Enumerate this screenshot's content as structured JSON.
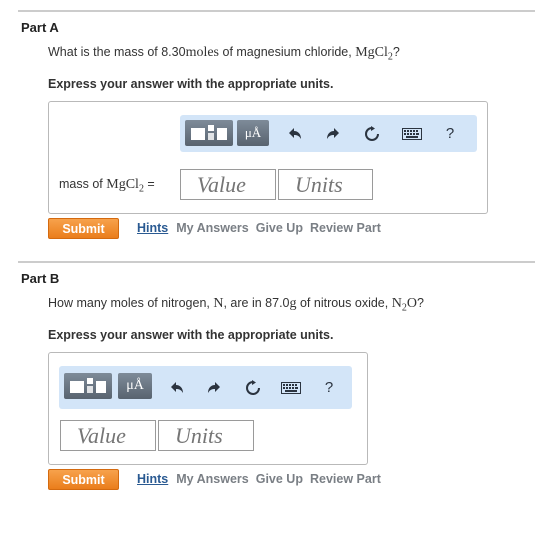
{
  "partA": {
    "title": "Part A",
    "question_pre": "What is the mass of 8.30",
    "question_unit": "moles",
    "question_mid": " of magnesium chloride, ",
    "question_formula_main": "MgCl",
    "question_formula_sub": "2",
    "question_post": "?",
    "instruction": "Express your answer with the appropriate units.",
    "label_pre": "mass of ",
    "label_formula_main": "MgCl",
    "label_formula_sub": "2",
    "label_eq": " =",
    "value_placeholder": "Value",
    "units_placeholder": "Units",
    "submit": "Submit",
    "hints": "Hints",
    "my_answers": "My Answers",
    "give_up": "Give Up",
    "review": "Review Part",
    "toolbar": {
      "micro": "μÅ",
      "help": "?"
    }
  },
  "partB": {
    "title": "Part B",
    "question_pre": "How many moles of nitrogen, ",
    "question_element": "N",
    "question_mid": ", are in 87.0",
    "question_unit": "g",
    "question_mid2": " of nitrous oxide, ",
    "question_formula_main": "N",
    "question_formula_sub": "2",
    "question_formula_end": "O",
    "question_post": "?",
    "instruction": "Express your answer with the appropriate units.",
    "value_placeholder": "Value",
    "units_placeholder": "Units",
    "submit": "Submit",
    "hints": "Hints",
    "my_answers": "My Answers",
    "give_up": "Give Up",
    "review": "Review Part",
    "toolbar": {
      "micro": "μÅ",
      "help": "?"
    }
  }
}
